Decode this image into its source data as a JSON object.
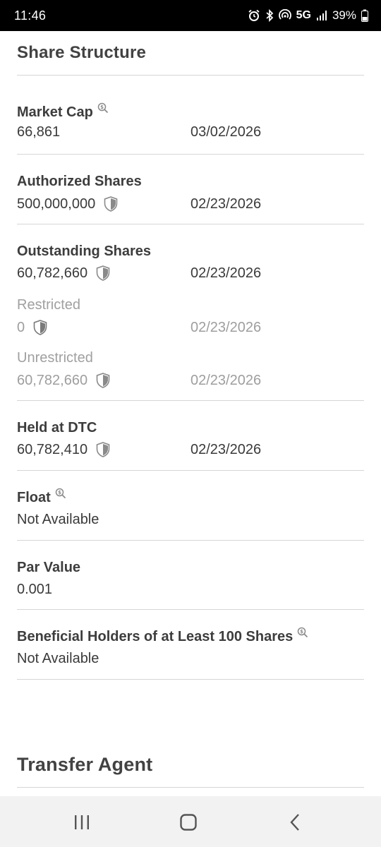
{
  "status_bar": {
    "time": "11:46",
    "network": "5G",
    "battery": "39%"
  },
  "share_structure": {
    "title": "Share Structure",
    "market_cap": {
      "label": "Market Cap",
      "value": "66,861",
      "date": "03/02/2026"
    },
    "authorized": {
      "label": "Authorized Shares",
      "value": "500,000,000",
      "date": "02/23/2026"
    },
    "outstanding": {
      "label": "Outstanding Shares",
      "value": "60,782,660",
      "date": "02/23/2026"
    },
    "restricted": {
      "label": "Restricted",
      "value": "0",
      "date": "02/23/2026"
    },
    "unrestricted": {
      "label": "Unrestricted",
      "value": "60,782,660",
      "date": "02/23/2026"
    },
    "held_dtc": {
      "label": "Held at DTC",
      "value": "60,782,410",
      "date": "02/23/2026"
    },
    "float": {
      "label": "Float",
      "value": "Not Available"
    },
    "par_value": {
      "label": "Par Value",
      "value": "0.001"
    },
    "beneficial": {
      "label": "Beneficial Holders of at Least 100 Shares",
      "value": "Not Available"
    }
  },
  "transfer_agent": {
    "title": "Transfer Agent"
  },
  "icons": {
    "shield": "shield-icon",
    "search_dollar": "search-dollar-icon"
  }
}
